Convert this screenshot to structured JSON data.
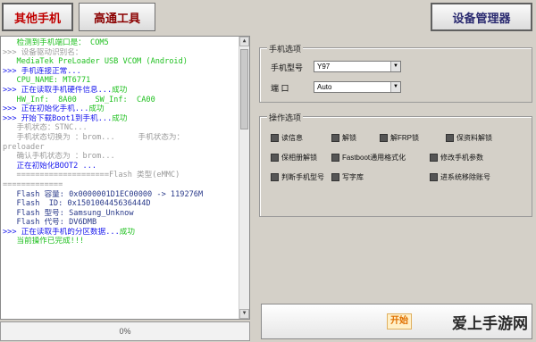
{
  "toolbar": {
    "other_phone": "其他手机",
    "qualcomm_tool": "高通工具",
    "device_manager": "设备管理器"
  },
  "log": {
    "lines": [
      {
        "text": "   检测到手机端口是： COM5",
        "style": "green"
      },
      {
        "text": ">>> 设备驱动识别名：",
        "style": "gray"
      },
      {
        "text": "   MediaTek PreLoader USB VCOM (Android)",
        "style": "green"
      },
      {
        "text": ">>> 手机连接正常...",
        "style": "blue"
      },
      {
        "text": "   CPU_NAME: MT6771",
        "style": "green"
      },
      {
        "text": ">>> 正在读取手机硬件信息...",
        "style": "blue",
        "tail": "成功"
      },
      {
        "text": "   HW_Inf:  8A00    SW_Inf:  CA00",
        "style": "green"
      },
      {
        "text": ">>> 正在初始化手机...",
        "style": "blue",
        "tail": "成功"
      },
      {
        "text": ">>> 开始下载Boot1到手机...",
        "style": "blue",
        "tail": "成功"
      },
      {
        "text": "   手机状态：STNC...",
        "style": "gray"
      },
      {
        "text": "   手机状态切换为 ：brom...     手机状态为：",
        "style": "gray"
      },
      {
        "text": "preloader",
        "style": "gray"
      },
      {
        "text": "   确认手机状态为 ：brom...",
        "style": "gray"
      },
      {
        "text": "   正在初始化BOOT2 ...",
        "style": "blue"
      },
      {
        "text": "   ====================Flash 类型(eMMC)",
        "style": "gray"
      },
      {
        "text": "=============",
        "style": "gray"
      },
      {
        "text": "   Flash 容量: 0x0000001D1EC00000 -> 119276M",
        "style": "navy"
      },
      {
        "text": "   Flash  ID: 0x150100445636444D",
        "style": "navy"
      },
      {
        "text": "   Flash 型号: Samsung_Unknow",
        "style": "navy"
      },
      {
        "text": "   Flash 代号: DV6DMB",
        "style": "navy"
      },
      {
        "text": ">>> 正在读取手机的分区数据...",
        "style": "blue",
        "tail": "成功"
      },
      {
        "text": "   当前操作已完成!!!",
        "style": "green"
      }
    ]
  },
  "progress": {
    "value": 0,
    "label": "0%"
  },
  "phone_options": {
    "title": "手机选项",
    "model_label": "手机型号",
    "model_value": "Y97",
    "port_label": "端    口",
    "port_value": "Auto"
  },
  "operations": {
    "title": "操作选项",
    "items": [
      "读信息",
      "解锁",
      "解FRP锁",
      "保资料解锁",
      "保相册解锁",
      "Fastboot通用格式化",
      "修改手机参数",
      "判断手机型号",
      "写字库",
      "进系统移除账号"
    ]
  },
  "start_button": {
    "label": "开始"
  },
  "watermark": "爱上手游网"
}
